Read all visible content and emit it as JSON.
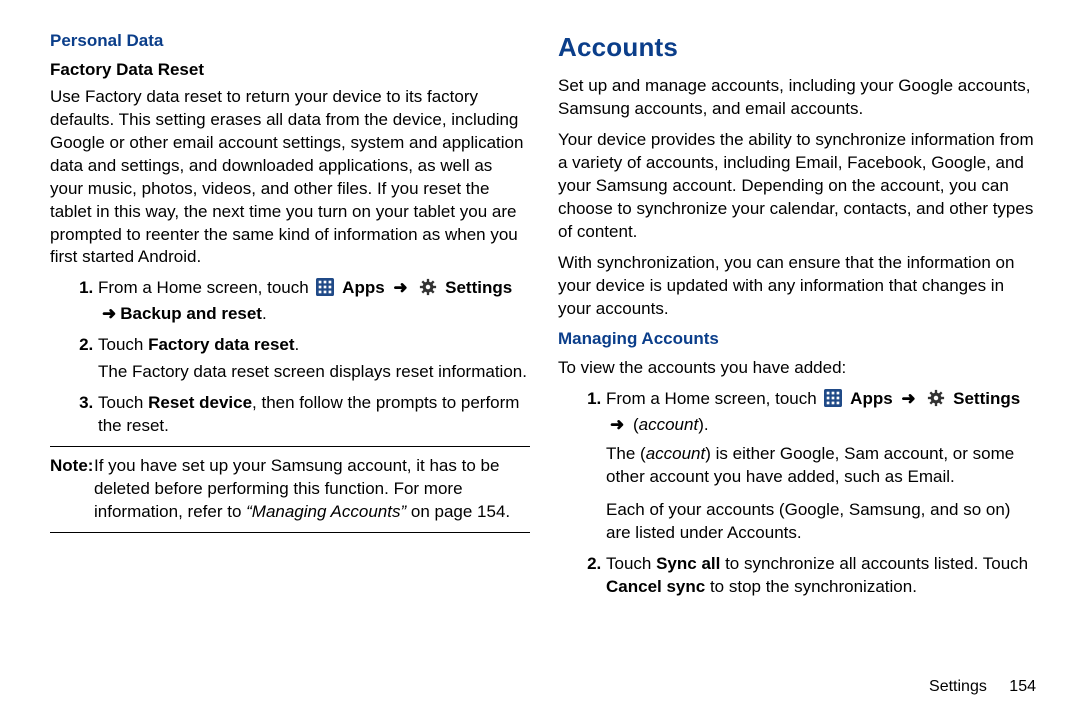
{
  "left": {
    "personal_data": "Personal Data",
    "factory_data_reset": "Factory Data Reset",
    "intro": "Use Factory data reset to return your device to its factory defaults. This setting erases all data from the device, including Google or other email account settings, system and application data and settings, and downloaded applications, as well as your music, photos, videos, and other files. If you reset the tablet in this way, the next time you turn on your tablet you are prompted to reenter the same kind of information as when you first started Android.",
    "step1_a": "From a Home screen, touch",
    "step1_apps": "Apps",
    "step1_settings": "Settings",
    "step1_b": "Backup and reset",
    "step2_a": "Touch ",
    "step2_b": "Factory data reset",
    "step2_sub": "The Factory data reset screen displays reset information.",
    "step3_a": "Touch ",
    "step3_b": "Reset device",
    "step3_c": ", then follow the prompts to perform the reset.",
    "note_label": "Note:",
    "note_body_a": "If you have set up your Samsung account, it has to be deleted before performing this function. For more information, refer to ",
    "note_body_i": "“Managing Accounts”",
    "note_body_b": " on page 154."
  },
  "right": {
    "accounts": "Accounts",
    "p1": "Set up and manage accounts, including your Google accounts, Samsung accounts, and email accounts.",
    "p2": "Your device provides the ability to synchronize information from a variety of accounts, including Email, Facebook, Google, and your Samsung account. Depending on the account, you can choose to synchronize your calendar, contacts, and other types of content.",
    "p3": "With synchronization, you can ensure that the information on your device is updated with any information that changes in your accounts.",
    "managing": "Managing Accounts",
    "view_intro": "To view the accounts you have added:",
    "r1_a": "From a Home screen, touch",
    "r1_apps": "Apps",
    "r1_settings": "Settings",
    "r1_account": "account",
    "r1_sub_a": "The (",
    "r1_sub_b": ") is either Google, Sam account, or some other account you have added, such as Email.",
    "r1_sub2": "Each of your accounts (Google, Samsung, and so on) are listed under Accounts.",
    "r2_a": "Touch ",
    "r2_b": "Sync all",
    "r2_c": " to synchronize all accounts listed. Touch ",
    "r2_d": "Cancel sync",
    "r2_e": " to stop the synchronization."
  },
  "footer": {
    "section": "Settings",
    "page": "154"
  },
  "arrow": "➜"
}
